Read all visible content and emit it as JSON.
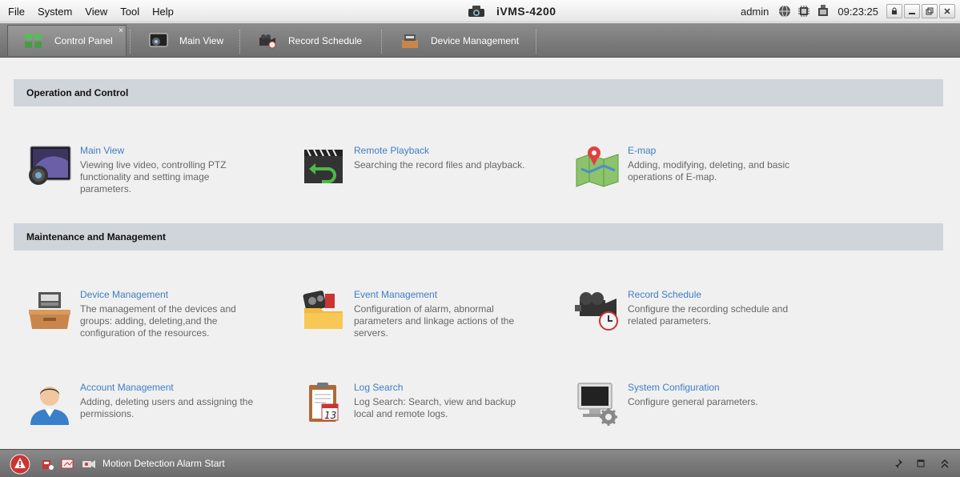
{
  "menu": {
    "items": [
      "File",
      "System",
      "View",
      "Tool",
      "Help"
    ]
  },
  "app": {
    "title": "iVMS-4200"
  },
  "title_right": {
    "user": "admin",
    "time": "09:23:25"
  },
  "tabs": [
    {
      "label": "Control Panel",
      "icon": "control-panel-icon",
      "active": true
    },
    {
      "label": "Main View",
      "icon": "main-view-icon"
    },
    {
      "label": "Record Schedule",
      "icon": "record-schedule-icon"
    },
    {
      "label": "Device Management",
      "icon": "device-management-icon"
    }
  ],
  "tab_close": "×",
  "sections": {
    "op": "Operation and Control",
    "maint": "Maintenance and Management"
  },
  "cards": {
    "main_view": {
      "title": "Main View",
      "desc": "Viewing live video, controlling PTZ functionality and setting image parameters."
    },
    "remote_playback": {
      "title": "Remote Playback",
      "desc": "Searching the record files and playback."
    },
    "emap": {
      "title": "E-map",
      "desc": "Adding, modifying, deleting, and basic operations of E-map."
    },
    "device_mgmt": {
      "title": "Device Management",
      "desc": "The management of the devices and groups: adding, deleting,and the configuration of the resources."
    },
    "event_mgmt": {
      "title": "Event Management",
      "desc": "Configuration of alarm, abnormal parameters and linkage actions of the servers."
    },
    "record_schedule": {
      "title": "Record Schedule",
      "desc": "Configure the recording schedule and related parameters."
    },
    "account_mgmt": {
      "title": "Account Management",
      "desc": "Adding, deleting users and assigning the permissions."
    },
    "log_search": {
      "title": "Log Search",
      "desc": "Log Search: Search, view and backup local and remote logs."
    },
    "sys_config": {
      "title": "System Configuration",
      "desc": "Configure general parameters."
    }
  },
  "status": {
    "message": "Motion Detection Alarm Start"
  },
  "colors": {
    "link": "#3f7ec5",
    "section_bg": "#cfd5da",
    "bar": "#7a7a7a"
  }
}
